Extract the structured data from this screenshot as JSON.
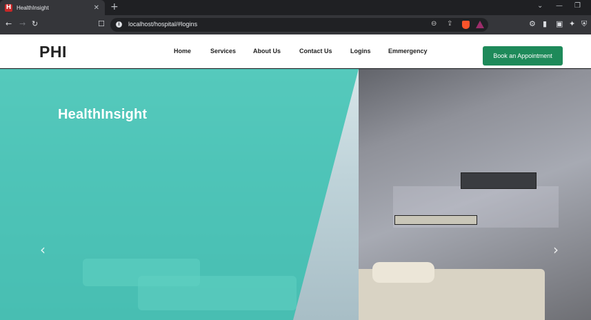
{
  "browser": {
    "tab_title": "HealthInsight",
    "favicon_letter": "H",
    "tab_close": "✕",
    "new_tab": "+",
    "url": "localhost/hospital/#logins"
  },
  "header": {
    "logo": "PHI",
    "nav": [
      "Home",
      "Services",
      "About Us",
      "Contact Us",
      "Logins",
      "Emmergency"
    ],
    "cta_label": "Book an Appointment"
  },
  "hero": {
    "title": "HealthInsight",
    "prev_arrow": "‹",
    "next_arrow": "›"
  },
  "colors": {
    "accent_green": "#1e8a5a",
    "overlay_teal": "#22beaa"
  }
}
